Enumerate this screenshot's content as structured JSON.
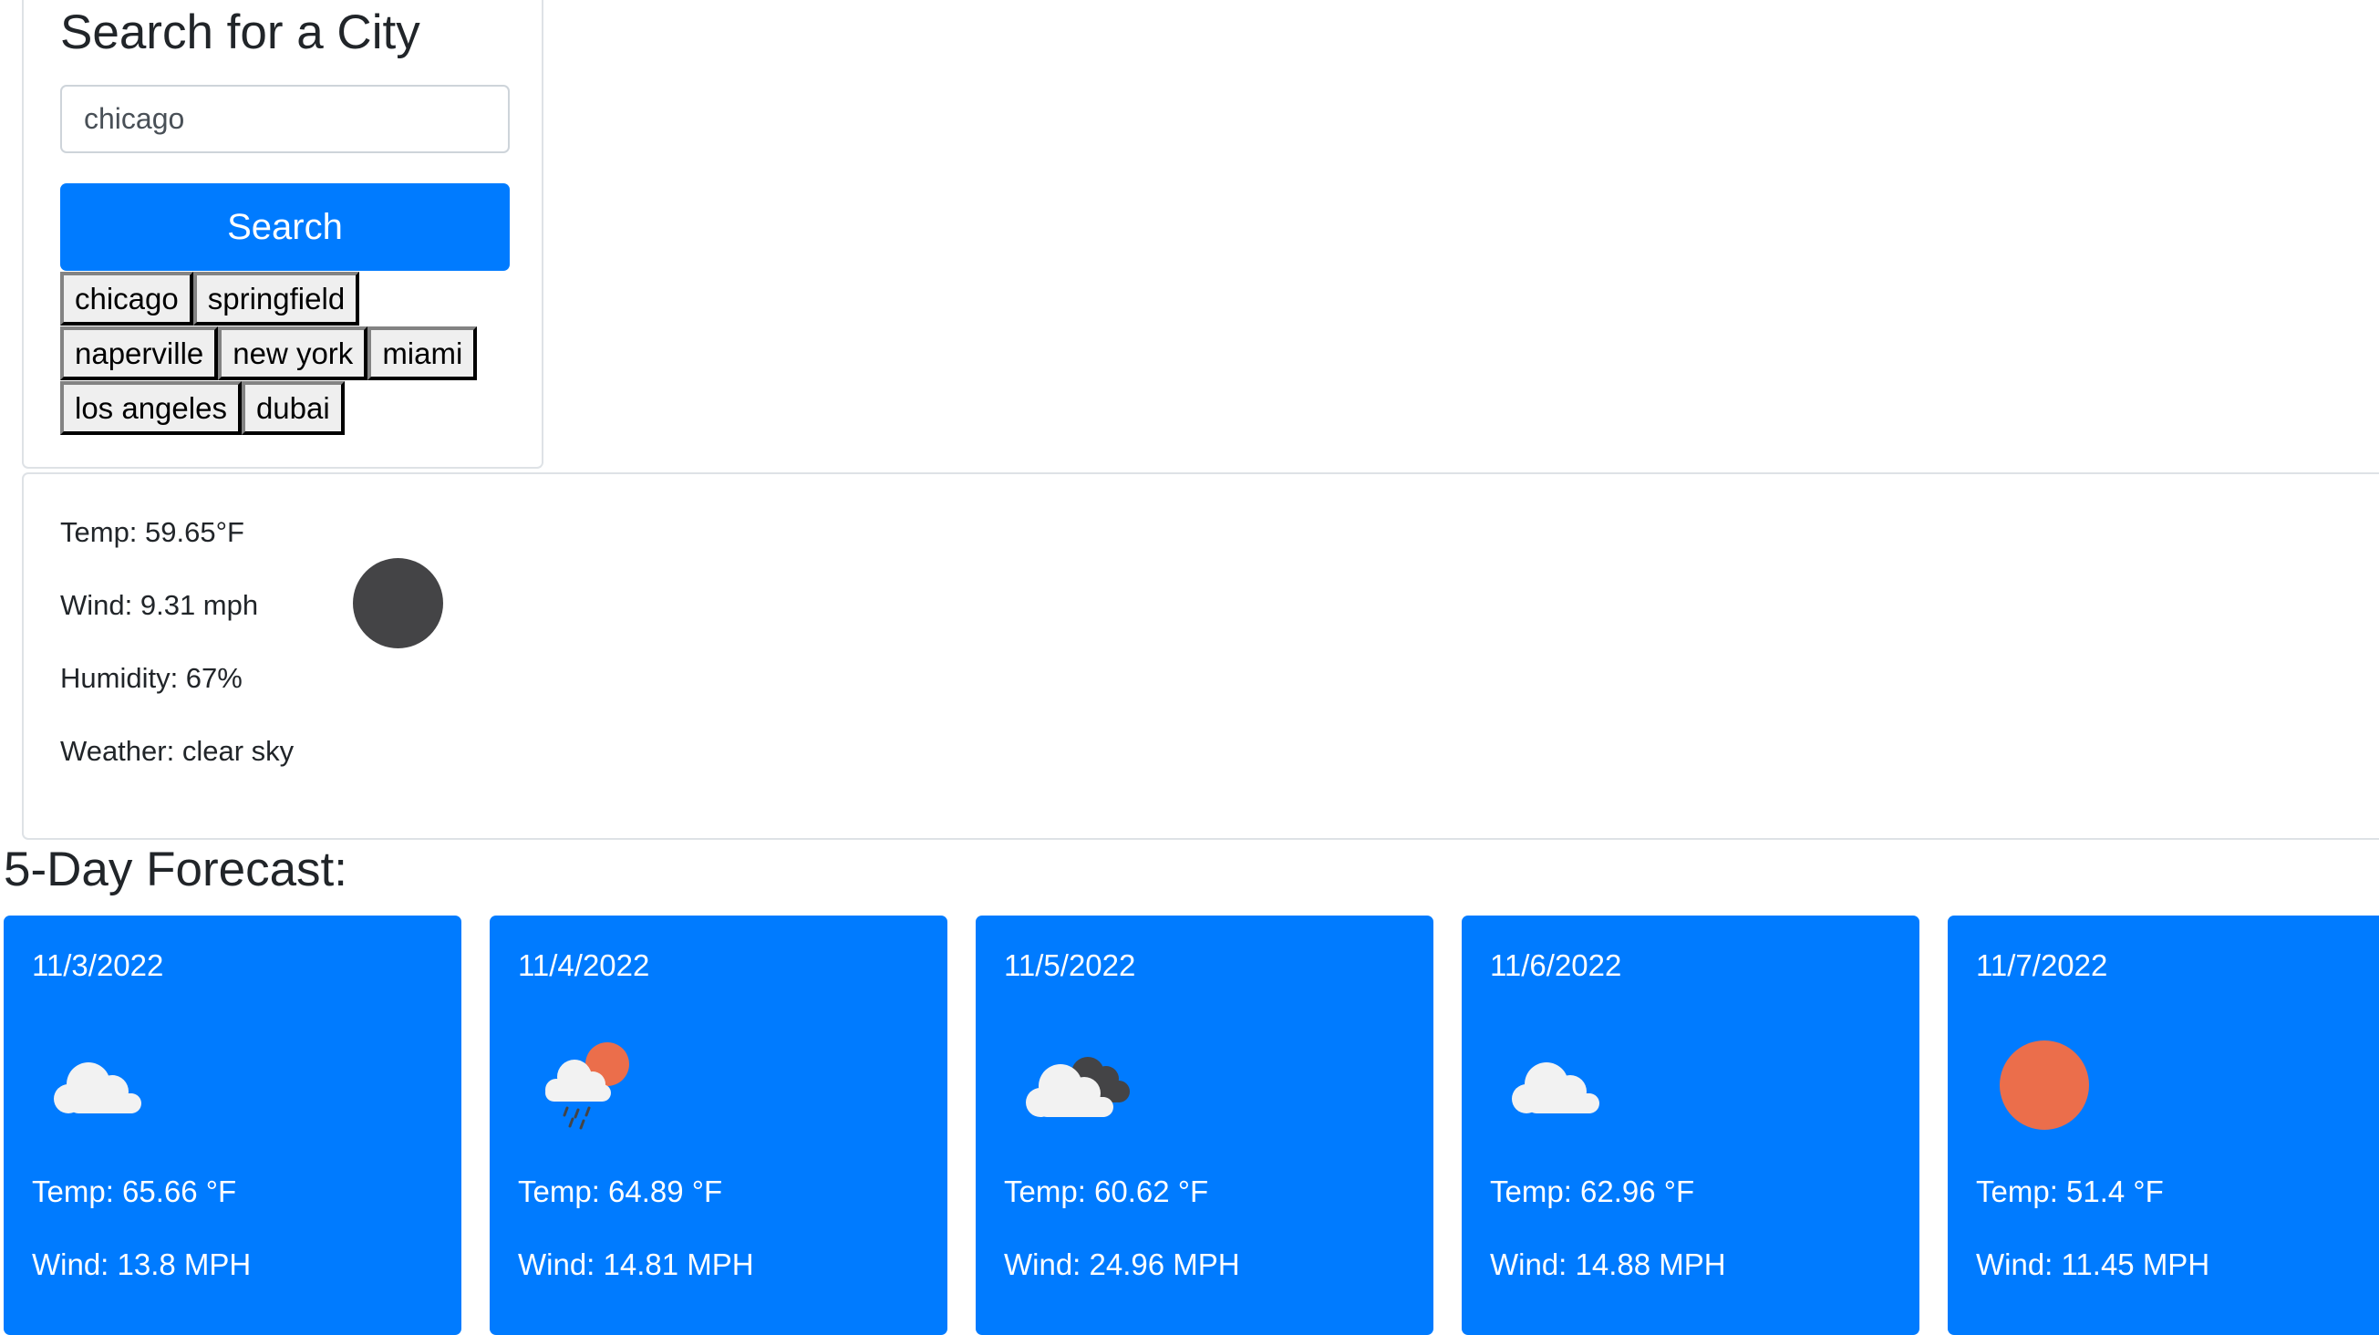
{
  "search": {
    "title": "Search for a City",
    "input_value": "chicago",
    "button_label": "Search"
  },
  "history": {
    "rows": [
      [
        "chicago",
        "springfield"
      ],
      [
        "naperville",
        "new york",
        "miami"
      ],
      [
        "los angeles",
        "dubai"
      ]
    ]
  },
  "current": {
    "temp": "Temp: 59.65°F",
    "wind": "Wind: 9.31 mph",
    "humidity": "Humidity: 67%",
    "weather": "Weather: clear sky",
    "icon": "clear-night-icon"
  },
  "forecast": {
    "title": "5-Day Forecast:",
    "days": [
      {
        "date": "11/3/2022",
        "temp": "Temp: 65.66 °F",
        "wind": "Wind: 13.8 MPH",
        "icon": "cloud-icon"
      },
      {
        "date": "11/4/2022",
        "temp": "Temp: 64.89 °F",
        "wind": "Wind: 14.81 MPH",
        "icon": "rain-sun-icon"
      },
      {
        "date": "11/5/2022",
        "temp": "Temp: 60.62 °F",
        "wind": "Wind: 24.96 MPH",
        "icon": "broken-clouds-icon"
      },
      {
        "date": "11/6/2022",
        "temp": "Temp: 62.96 °F",
        "wind": "Wind: 14.88 MPH",
        "icon": "cloud-icon"
      },
      {
        "date": "11/7/2022",
        "temp": "Temp: 51.4 °F",
        "wind": "Wind: 11.45 MPH",
        "icon": "sun-icon"
      }
    ]
  },
  "colors": {
    "primary": "#007bff",
    "moon": "#444446",
    "sun": "#eb6e4b",
    "cloud": "#f2f2f2",
    "dark_cloud": "#444446"
  }
}
